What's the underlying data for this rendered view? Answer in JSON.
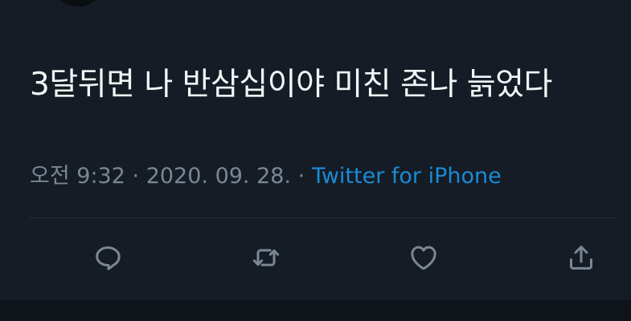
{
  "tweet": {
    "text": "3달뒤면 나 반삼십이야 미친 존나 늙었다",
    "time": "오전 9:32",
    "separator": "·",
    "date": "2020. 09. 28.",
    "source": "Twitter for iPhone"
  },
  "actions": [
    {
      "name": "reply",
      "icon": "reply-icon"
    },
    {
      "name": "retweet",
      "icon": "retweet-icon"
    },
    {
      "name": "like",
      "icon": "heart-icon"
    },
    {
      "name": "share",
      "icon": "share-icon"
    }
  ],
  "colors": {
    "background": "#151c25",
    "text": "#f3f5f7",
    "meta": "#7b8793",
    "link": "#1b8ad6"
  }
}
